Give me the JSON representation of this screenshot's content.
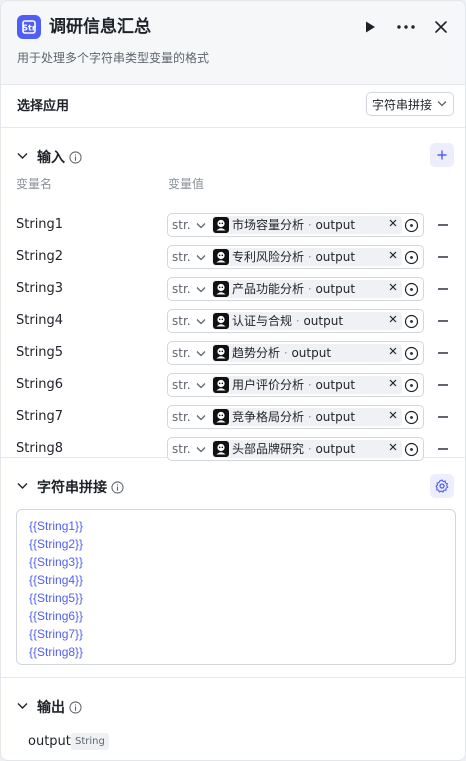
{
  "header": {
    "title": "调研信息汇总",
    "subtitle": "用于处理多个字符串类型变量的格式",
    "icons": {
      "app": "text-concat-icon",
      "run": "play-icon",
      "more": "ellipsis-icon",
      "close": "close-icon"
    }
  },
  "select_app": {
    "label": "选择应用",
    "value": "字符串拼接"
  },
  "input": {
    "title": "输入",
    "col_name": "变量名",
    "col_value": "变量值",
    "rows": [
      {
        "name": "String1",
        "type": "str.",
        "node": "市场容量分析",
        "sep": " · ",
        "field": "output"
      },
      {
        "name": "String2",
        "type": "str.",
        "node": "专利风险分析",
        "sep": " · ",
        "field": "output"
      },
      {
        "name": "String3",
        "type": "str.",
        "node": "产品功能分析",
        "sep": " · ",
        "field": "output"
      },
      {
        "name": "String4",
        "type": "str.",
        "node": "认证与合规",
        "sep": " · ",
        "field": "output"
      },
      {
        "name": "String5",
        "type": "str.",
        "node": "趋势分析",
        "sep": " · ",
        "field": "output"
      },
      {
        "name": "String6",
        "type": "str.",
        "node": "用户评价分析",
        "sep": " · ",
        "field": "output"
      },
      {
        "name": "String7",
        "type": "str.",
        "node": "竞争格局分析",
        "sep": " · ",
        "field": "output"
      },
      {
        "name": "String8",
        "type": "str.",
        "node": "头部品牌研究",
        "sep": " · ",
        "field": "output"
      }
    ]
  },
  "concat": {
    "title": "字符串拼接",
    "lines": [
      "{{String1}}",
      "{{String2}}",
      "{{String3}}",
      "{{String4}}",
      "{{String5}}",
      "{{String6}}",
      "{{String7}}",
      "{{String8}}"
    ]
  },
  "output": {
    "title": "输出",
    "name": "output",
    "type": "String"
  },
  "colors": {
    "accent": "#4e5ef7",
    "accent_bg": "#eceefe",
    "border": "#d3d6dc"
  }
}
